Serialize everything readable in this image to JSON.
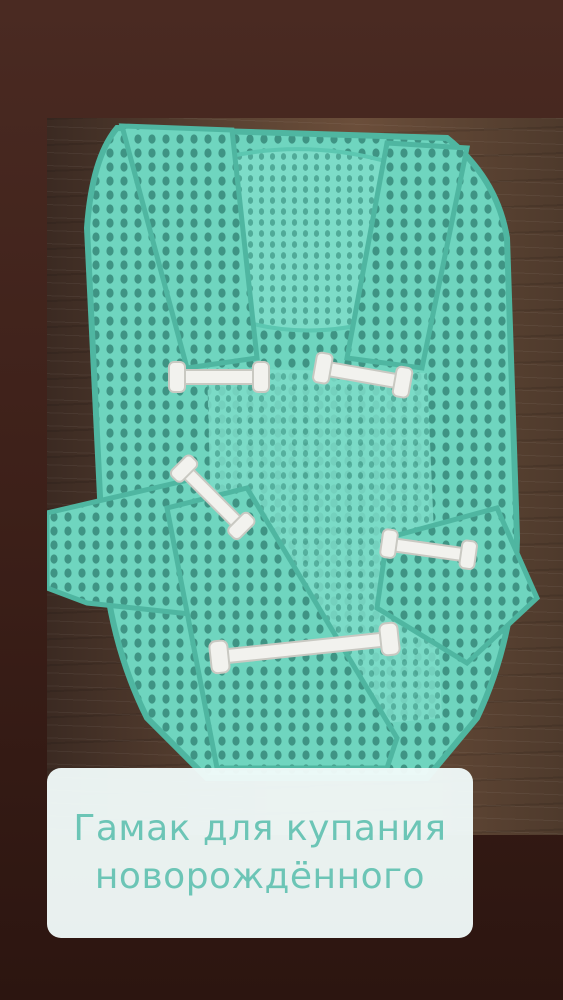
{
  "photo": {
    "subject": "mint mesh baby bath hammock with white plastic clips"
  },
  "caption": {
    "line1": "Гамак для купания",
    "line2": "новорождённого",
    "color": "#6cc5b6",
    "background": "#f0faf9"
  },
  "colors": {
    "mesh": "#6fd5bf",
    "mesh_dark": "#4fb6a1",
    "clips": "#f2f2ee",
    "wood": "#5a4232"
  }
}
